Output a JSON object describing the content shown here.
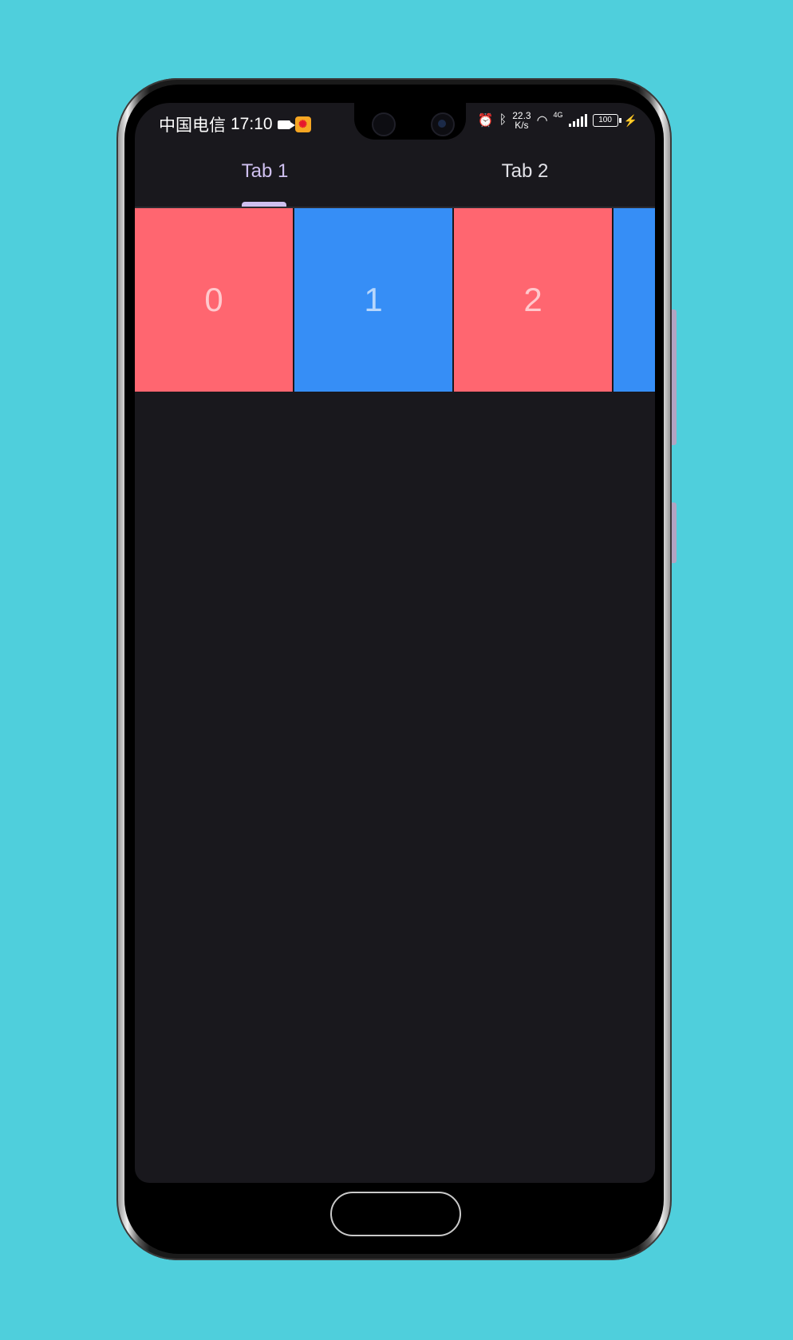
{
  "status_bar": {
    "carrier": "中国电信",
    "time": "17:10",
    "speed_value": "22.3",
    "speed_unit": "K/s",
    "network": "4G",
    "battery": "100"
  },
  "tabs": [
    {
      "label": "Tab 1",
      "selected": true
    },
    {
      "label": "Tab 2",
      "selected": false
    }
  ],
  "cards": [
    {
      "label": "0",
      "color": "#ff6670"
    },
    {
      "label": "1",
      "color": "#368ef6"
    },
    {
      "label": "2",
      "color": "#ff6670"
    },
    {
      "label": "",
      "color": "#368ef6"
    }
  ],
  "colors": {
    "background": "#4fcfdc",
    "screen": "#19181d",
    "accent": "#cfc0f0"
  }
}
